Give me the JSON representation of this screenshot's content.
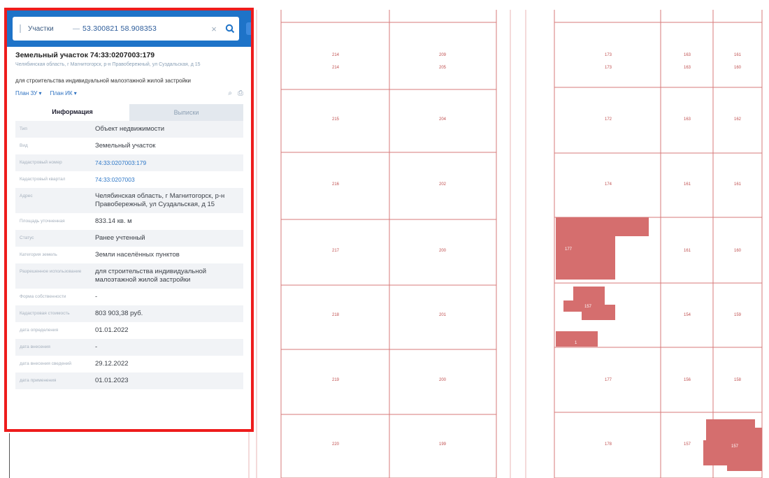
{
  "search": {
    "type_label": "Участки",
    "value": "53.300821 58.908353"
  },
  "parcel": {
    "title": "Земельный участок 74:33:0207003:179",
    "address_small": "Челябинская область, г Магнитогорск, р-н Правобережный, ул Суздальская, д 15",
    "use": "для строительства индивидуальной малоэтажной жилой застройки",
    "plan_links": [
      "План ЗУ ▾",
      "План ИК ▾"
    ]
  },
  "tabs": [
    "Информация",
    "Выписки"
  ],
  "attributes": [
    {
      "label": "Тип",
      "value": "Объект недвижимости",
      "link": false
    },
    {
      "label": "Вид",
      "value": "Земельный участок",
      "link": false
    },
    {
      "label": "Кадастровый номер",
      "value": "74:33:0207003:179",
      "link": true
    },
    {
      "label": "Кадастровый квартал",
      "value": "74:33:0207003",
      "link": true
    },
    {
      "label": "Адрес",
      "value": "Челябинская область, г Магнитогорск, р-н Правобережный, ул Суздальская, д 15",
      "link": false
    },
    {
      "label": "Площадь уточненная",
      "value": "833.14 кв. м",
      "link": false
    },
    {
      "label": "Статус",
      "value": "Ранее учтенный",
      "link": false
    },
    {
      "label": "Категория земель",
      "value": "Земли населённых пунктов",
      "link": false
    },
    {
      "label": "Разрешенное использование",
      "value": "для строительства индивидуальной малоэтажной жилой застройки",
      "link": false
    },
    {
      "label": "Форма собственности",
      "value": "-",
      "link": false
    },
    {
      "label": "Кадастровая стоимость",
      "value": "803 903,38 руб.",
      "link": false
    },
    {
      "label": "дата определения",
      "value": "01.01.2022",
      "link": false
    },
    {
      "label": "дата внесения",
      "value": "-",
      "link": false
    },
    {
      "label": "дата внесения сведений",
      "value": "29.12.2022",
      "link": false
    },
    {
      "label": "дата применения",
      "value": "01.01.2023",
      "link": false
    }
  ],
  "map": {
    "parcel_numbers": [
      [
        "214",
        "209",
        "173",
        "163",
        "161"
      ],
      [
        "214",
        "205",
        "173",
        "163",
        "160"
      ],
      [
        "215",
        "204",
        "172",
        "163",
        "162"
      ],
      [
        "216",
        "202",
        "174",
        "161",
        "161"
      ],
      [
        "217",
        "200",
        "",
        "161",
        "160"
      ],
      [
        "218",
        "201",
        "",
        "154",
        "159"
      ],
      [
        "219",
        "200",
        "177",
        "156",
        "158"
      ],
      [
        "220",
        "199",
        "178",
        "157",
        ""
      ]
    ],
    "building_labels": [
      "177",
      "9",
      "157",
      "1",
      "157"
    ]
  }
}
